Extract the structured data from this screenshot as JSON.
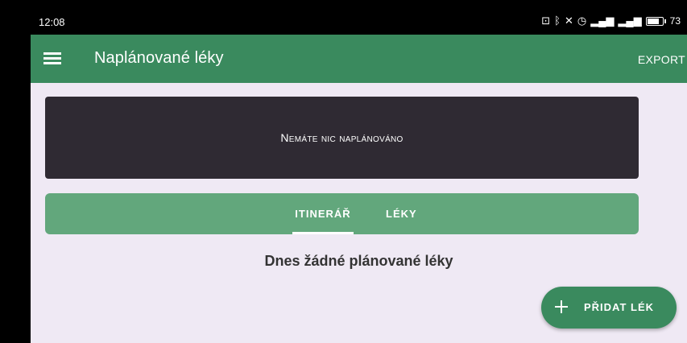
{
  "status_bar": {
    "time": "12:08",
    "battery_percent": "73",
    "icons": [
      "nfc-icon",
      "bluetooth-icon",
      "mute-icon",
      "alarm-icon",
      "signal-icon",
      "signal-4g-icon",
      "battery-icon"
    ]
  },
  "app_bar": {
    "title": "Naplánované léky",
    "export_label": "EXPORT"
  },
  "banner": {
    "text": "Nemáte nic naplánováno"
  },
  "tabs": {
    "items": [
      {
        "label": "ITINERÁŘ",
        "selected": true
      },
      {
        "label": "LÉKY",
        "selected": false
      }
    ]
  },
  "main": {
    "empty_message": "Dnes žádné plánované léky"
  },
  "fab": {
    "label": "PŘIDAT LÉK"
  },
  "colors": {
    "primary": "#3a8a5e",
    "tab_bar": "#62a77c",
    "banner": "#2f2a33",
    "background": "#efe9f4"
  }
}
